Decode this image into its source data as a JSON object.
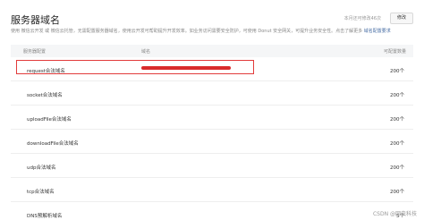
{
  "header": {
    "title": "服务器域名",
    "limit_text": "本月还可修改46次",
    "edit_label": "修改"
  },
  "description": {
    "text": "使用 微信云开发 或 微信云托管，无需配置服务器域名，使用云开发可帮助提升开发效率。如业务访问需要安全防护，可使用 Donut 安全网关，可提升业务安全性。点击了解更多",
    "link": "域名配置要求"
  },
  "table": {
    "headers": [
      "服务器配置",
      "域名",
      "可配置数量"
    ],
    "rows": [
      {
        "name": "request合法域名",
        "count": "200个"
      },
      {
        "name": "socket合法域名",
        "count": "200个"
      },
      {
        "name": "uploadFile合法域名",
        "count": "200个"
      },
      {
        "name": "downloadFile合法域名",
        "count": "200个"
      },
      {
        "name": "udp合法域名",
        "count": "200个"
      },
      {
        "name": "tcp合法域名",
        "count": "200个"
      },
      {
        "name": "DNS预解析域名",
        "count": "5个"
      }
    ]
  },
  "watermark": "CSDN @网虫科技",
  "colors": {
    "highlight_border": "#e23b3b",
    "redaction": "#d92b2b"
  }
}
